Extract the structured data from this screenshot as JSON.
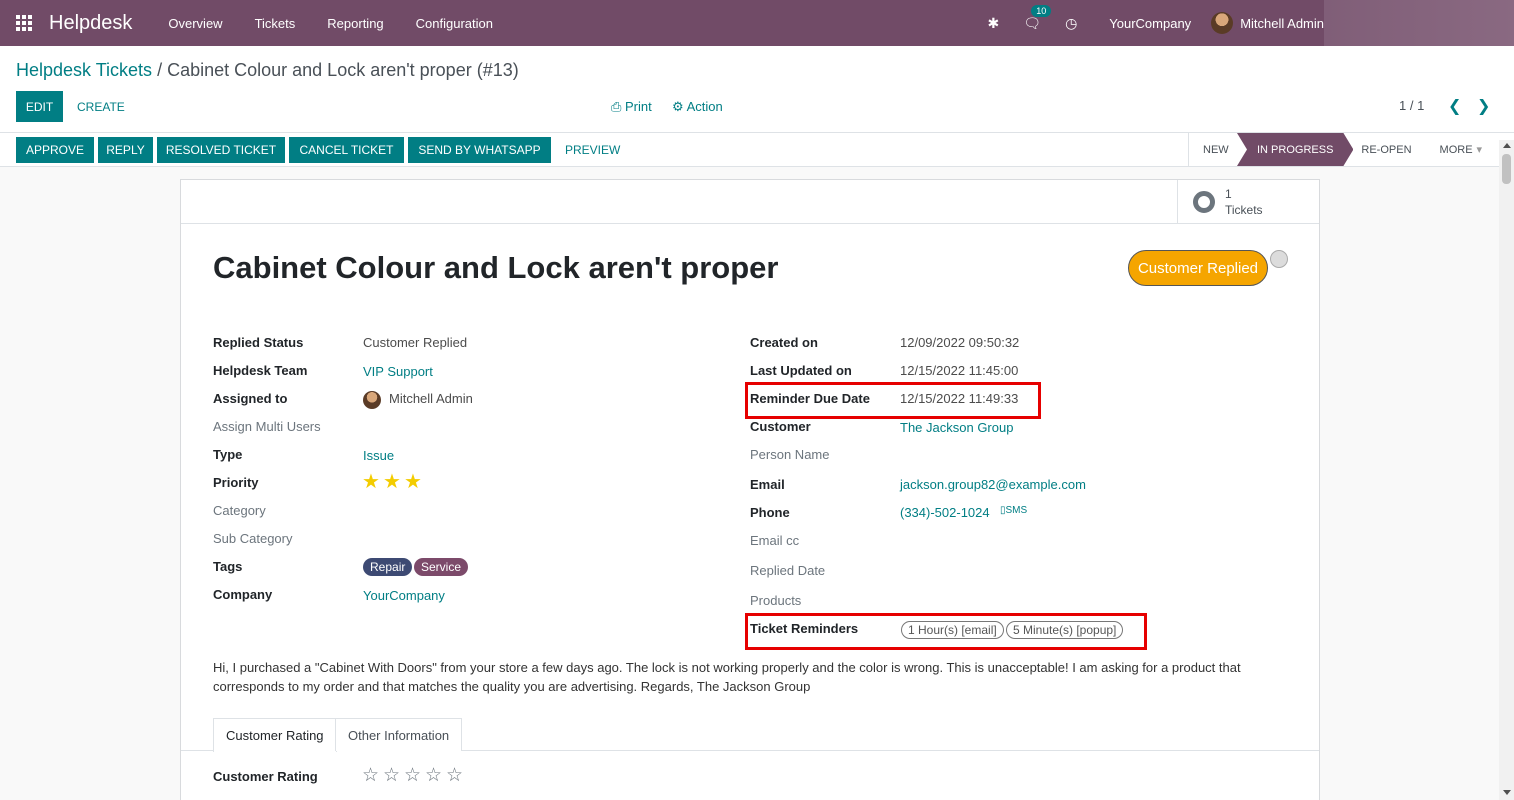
{
  "nav": {
    "brand": "Helpdesk",
    "menu": [
      "Overview",
      "Tickets",
      "Reporting",
      "Configuration"
    ],
    "messages_count": "10",
    "company": "YourCompany",
    "user": "Mitchell Admin"
  },
  "control": {
    "breadcrumb_parent": "Helpdesk Tickets",
    "breadcrumb_sep": " / ",
    "breadcrumb_current": "Cabinet Colour and Lock aren't proper (#13)",
    "edit_label": "EDIT",
    "create_label": "CREATE",
    "print_label": "Print",
    "action_label": "Action",
    "pager": "1 / 1"
  },
  "statusbar": {
    "buttons": [
      "APPROVE",
      "REPLY",
      "RESOLVED TICKET",
      "CANCEL TICKET",
      "SEND BY WHATSAPP"
    ],
    "preview_label": "PREVIEW",
    "stages": [
      "NEW",
      "IN PROGRESS",
      "RE-OPEN",
      "MORE"
    ],
    "active_stage": "IN PROGRESS"
  },
  "smart_button": {
    "count": "1",
    "label": "Tickets"
  },
  "ticket": {
    "title": "Cabinet Colour and Lock aren't proper",
    "replied_badge": "Customer Replied",
    "left_fields": {
      "replied_status_label": "Replied Status",
      "replied_status": "Customer Replied",
      "team_label": "Helpdesk Team",
      "team": "VIP Support",
      "assigned_label": "Assigned to",
      "assigned": "Mitchell Admin",
      "multi_users_label": "Assign Multi Users",
      "type_label": "Type",
      "type": "Issue",
      "priority_label": "Priority",
      "priority_stars": 3,
      "category_label": "Category",
      "subcategory_label": "Sub Category",
      "tags_label": "Tags",
      "tags": [
        "Repair",
        "Service"
      ],
      "company_label": "Company",
      "company": "YourCompany"
    },
    "right_fields": {
      "created_label": "Created on",
      "created": "12/09/2022 09:50:32",
      "updated_label": "Last Updated on",
      "updated": "12/15/2022 11:45:00",
      "reminder_due_label": "Reminder Due Date",
      "reminder_due": "12/15/2022 11:49:33",
      "customer_label": "Customer",
      "customer": "The Jackson Group",
      "person_label": "Person Name",
      "email_label": "Email",
      "email": "jackson.group82@example.com",
      "phone_label": "Phone",
      "phone": "(334)-502-1024",
      "sms": "SMS",
      "emailcc_label": "Email cc",
      "replied_date_label": "Replied Date",
      "products_label": "Products",
      "reminders_label": "Ticket Reminders",
      "reminders": [
        "1 Hour(s) [email]",
        "5 Minute(s) [popup]"
      ]
    },
    "description": "Hi, I purchased a \"Cabinet With Doors\" from your store a few days ago. The lock is not working properly and the color is wrong. This is unacceptable! I am asking for a product that corresponds to my order and that matches the quality you are advertising. Regards, The Jackson Group",
    "tabs": [
      "Customer Rating",
      "Other Information"
    ],
    "rating_label": "Customer Rating"
  },
  "colors": {
    "brand": "#714B67",
    "accent": "#017e84",
    "star": "#f3cc00",
    "badge": "#f5a500",
    "highlight": "#e60000"
  }
}
